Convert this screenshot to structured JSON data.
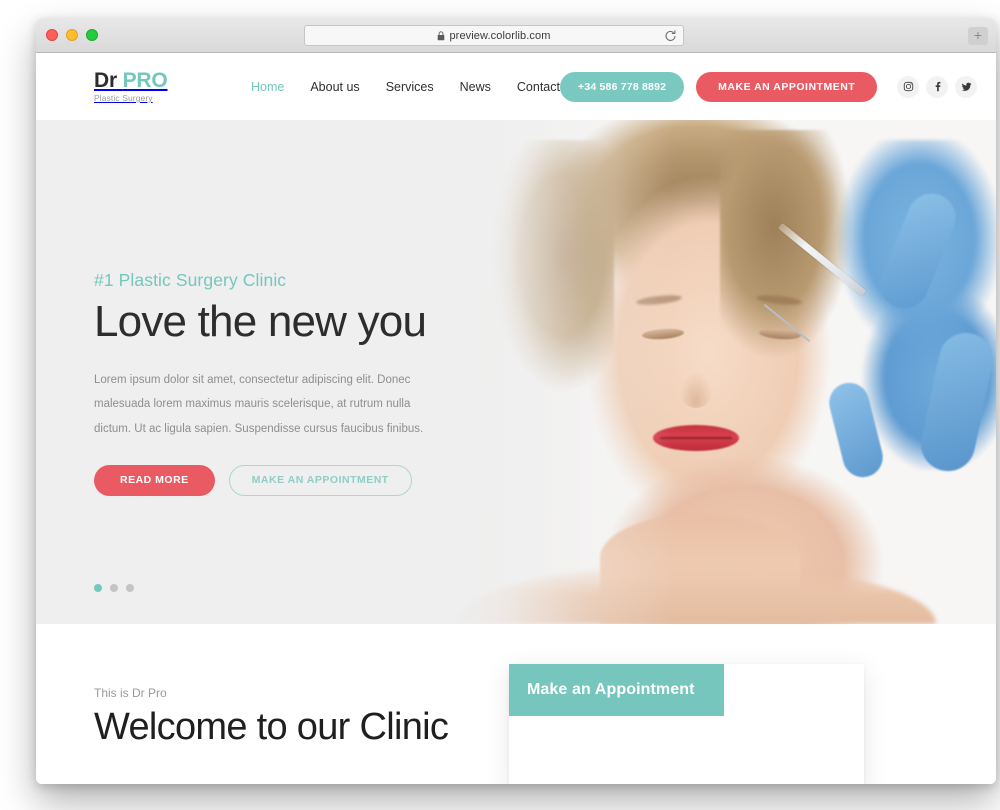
{
  "browser": {
    "url": "preview.colorlib.com",
    "lock_icon": "lock-icon",
    "reload_icon": "reload-icon",
    "new_tab_label": "+",
    "traffic_lights": [
      "close",
      "minimize",
      "maximize"
    ]
  },
  "site": {
    "logo": {
      "primary": "Dr",
      "accent": "PRO",
      "tagline": "Plastic Surgery"
    },
    "nav": [
      {
        "label": "Home",
        "active": true
      },
      {
        "label": "About us",
        "active": false
      },
      {
        "label": "Services",
        "active": false
      },
      {
        "label": "News",
        "active": false
      },
      {
        "label": "Contact",
        "active": false
      }
    ],
    "header_actions": {
      "phone": "+34 586 778 8892",
      "appointment": "MAKE AN APPOINTMENT"
    },
    "social": [
      {
        "name": "instagram-icon"
      },
      {
        "name": "facebook-icon"
      },
      {
        "name": "twitter-icon"
      }
    ]
  },
  "hero": {
    "eyebrow": "#1 Plastic Surgery Clinic",
    "title": "Love the new you",
    "description": "Lorem ipsum dolor sit amet, consectetur adipiscing elit. Donec malesuada lorem maximus mauris scelerisque, at rutrum nulla dictum. Ut ac ligula sapien. Suspendisse cursus faucibus finibus.",
    "primary_button": "READ MORE",
    "secondary_button": "MAKE AN APPOINTMENT",
    "slide_count": 3,
    "active_slide": 1
  },
  "welcome": {
    "eyebrow": "This is Dr Pro",
    "title": "Welcome to our Clinic"
  },
  "appointment_card": {
    "header": "Make an Appointment"
  },
  "colors": {
    "teal": "#74c7bd",
    "teal_button": "#79c9c0",
    "red": "#ea5a63",
    "hero_bg": "#efefef",
    "text_dark": "#2d2d2d",
    "text_muted": "#8e8e8e"
  }
}
